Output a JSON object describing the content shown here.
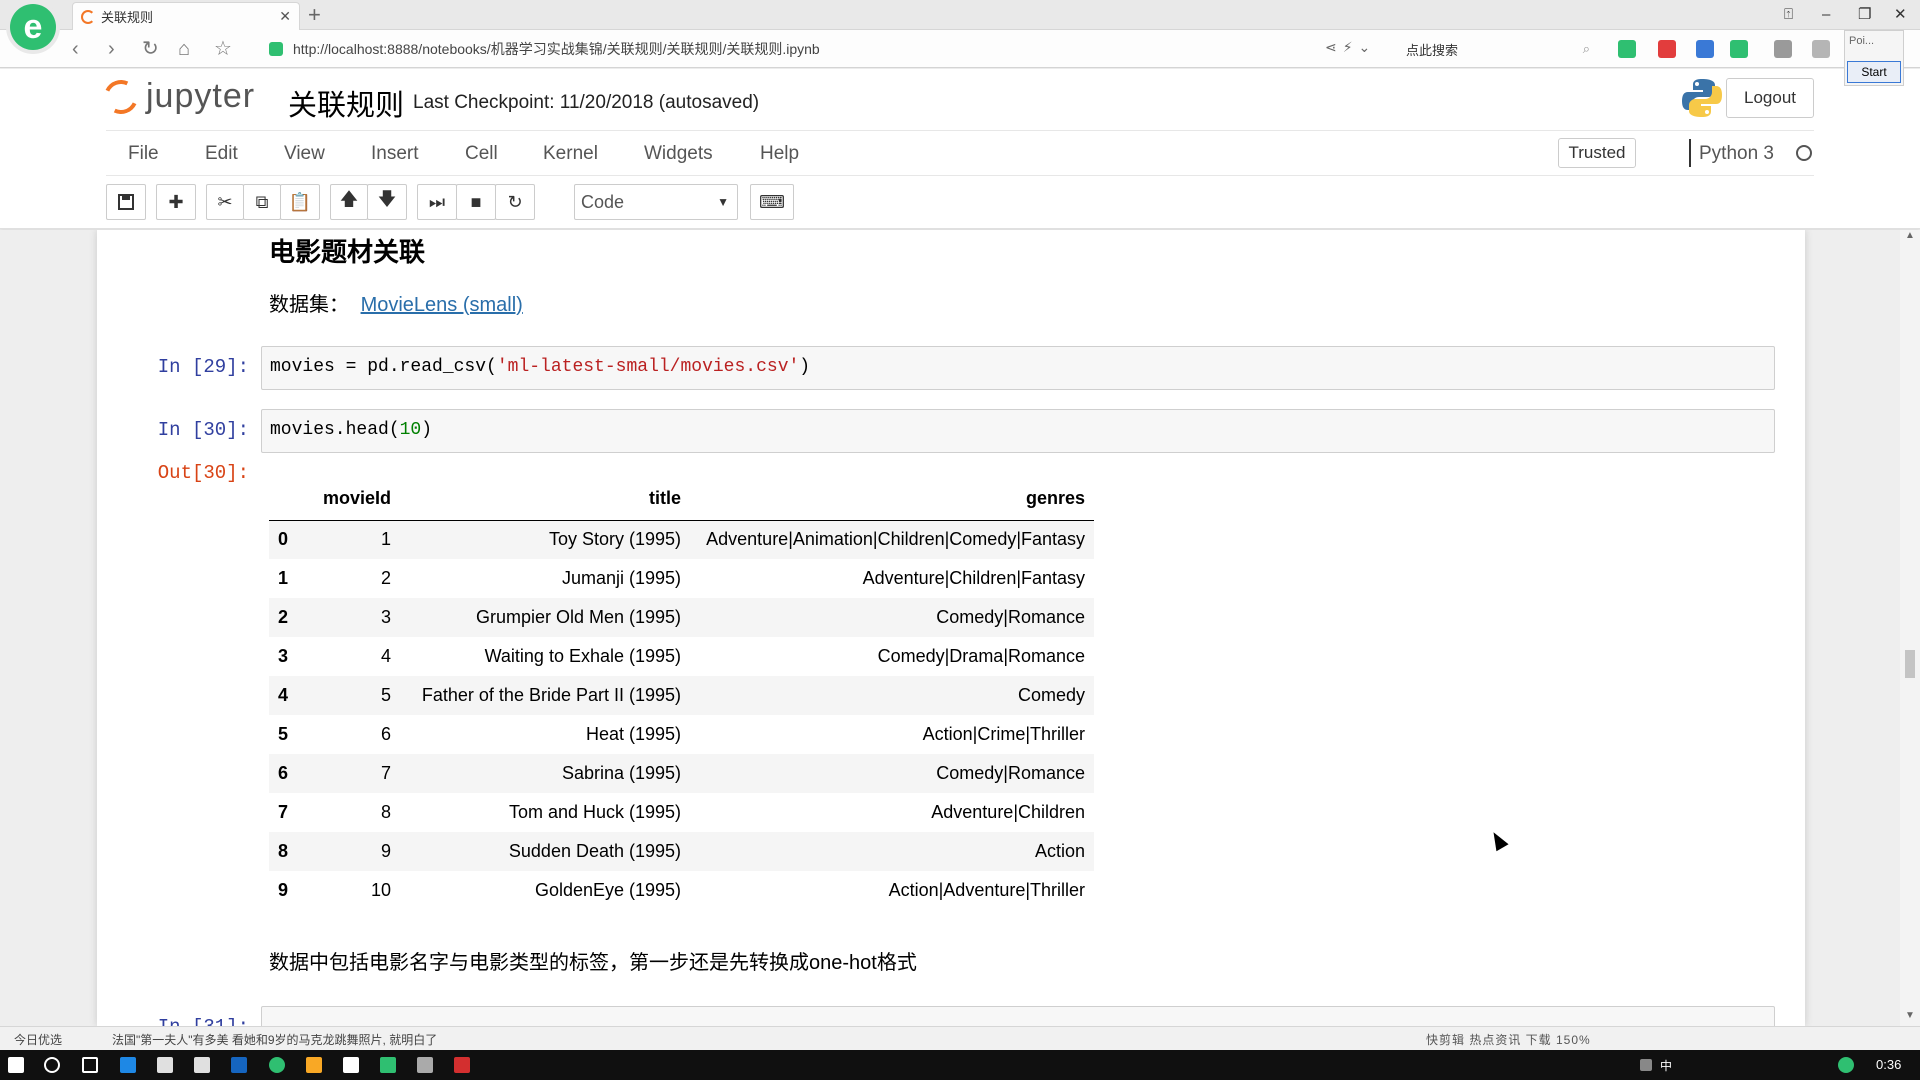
{
  "browser": {
    "tab_title": "关联规则",
    "url": "http://localhost:8888/notebooks/机器学习实战集锦/关联规则/关联规则/关联规则.ipynb",
    "search_placeholder": "点此搜索",
    "mini_panel_text": "Poi...",
    "mini_panel_button": "Start"
  },
  "jupyter": {
    "logo_text": "jupyter",
    "notebook_name": "关联规则",
    "checkpoint": "Last Checkpoint: 11/20/2018 (autosaved)",
    "logout_label": "Logout",
    "menu": [
      "File",
      "Edit",
      "View",
      "Insert",
      "Cell",
      "Kernel",
      "Widgets",
      "Help"
    ],
    "trusted_label": "Trusted",
    "kernel_name": "Python 3",
    "cell_type": "Code"
  },
  "notebook": {
    "heading": "电影题材关联",
    "dataset_label": "数据集：",
    "dataset_link": "MovieLens (small)",
    "cells": [
      {
        "prompt": "In [29]:",
        "code_prefix": "movies = pd.read_csv(",
        "code_str": "'ml-latest-small/movies.csv'",
        "code_suffix": ")"
      },
      {
        "prompt": "In [30]:",
        "code_prefix": "movies.head(",
        "code_num": "10",
        "code_suffix": ")"
      }
    ],
    "out_prompt": "Out[30]:",
    "table": {
      "columns": [
        "movieId",
        "title",
        "genres"
      ],
      "rows": [
        {
          "index": "0",
          "movieId": "1",
          "title": "Toy Story (1995)",
          "genres": "Adventure|Animation|Children|Comedy|Fantasy"
        },
        {
          "index": "1",
          "movieId": "2",
          "title": "Jumanji (1995)",
          "genres": "Adventure|Children|Fantasy"
        },
        {
          "index": "2",
          "movieId": "3",
          "title": "Grumpier Old Men (1995)",
          "genres": "Comedy|Romance"
        },
        {
          "index": "3",
          "movieId": "4",
          "title": "Waiting to Exhale (1995)",
          "genres": "Comedy|Drama|Romance"
        },
        {
          "index": "4",
          "movieId": "5",
          "title": "Father of the Bride Part II (1995)",
          "genres": "Comedy"
        },
        {
          "index": "5",
          "movieId": "6",
          "title": "Heat (1995)",
          "genres": "Action|Crime|Thriller"
        },
        {
          "index": "6",
          "movieId": "7",
          "title": "Sabrina (1995)",
          "genres": "Comedy|Romance"
        },
        {
          "index": "7",
          "movieId": "8",
          "title": "Tom and Huck (1995)",
          "genres": "Adventure|Children"
        },
        {
          "index": "8",
          "movieId": "9",
          "title": "Sudden Death (1995)",
          "genres": "Action"
        },
        {
          "index": "9",
          "movieId": "10",
          "title": "GoldenEye (1995)",
          "genres": "Action|Adventure|Thriller"
        }
      ]
    },
    "paragraph": "数据中包括电影名字与电影类型的标签，第一步还是先转换成one-hot格式",
    "next_prompt": "In [31]:"
  },
  "statusbar": {
    "left": "今日优选",
    "news": "法国\"第一夫人\"有多美 看她和9岁的马克龙跳舞照片, 就明白了",
    "right": "快剪辑   热点资讯      下载           150%"
  },
  "taskbar": {
    "tray_text": "中",
    "clock": "0:36"
  },
  "colors": {
    "jupyter_orange": "#f37726",
    "link_blue": "#296eaa",
    "in_prompt": "#303f9f",
    "out_prompt": "#d84315",
    "browser_green": "#2fbf71"
  }
}
